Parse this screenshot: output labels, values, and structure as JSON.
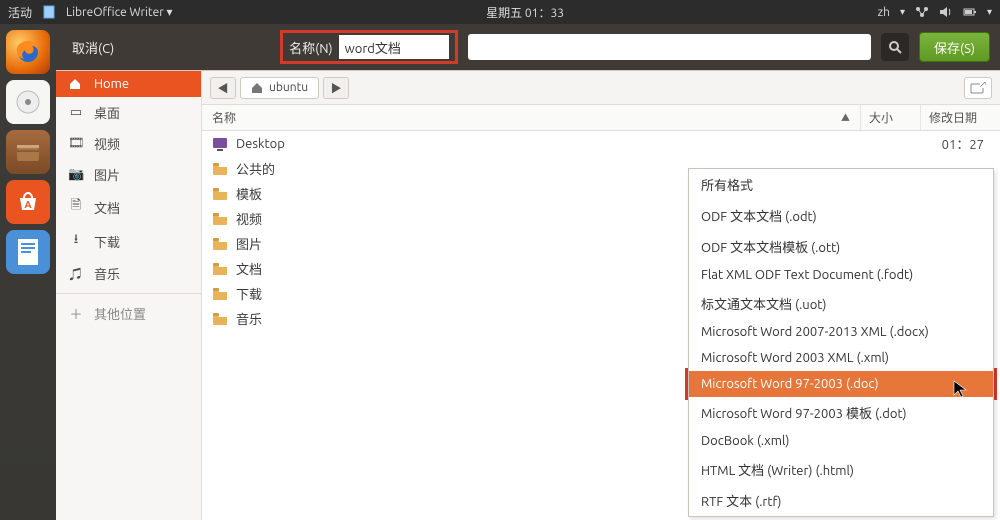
{
  "top": {
    "activities": "活动",
    "app_name": "LibreOffice Writer",
    "clock": "星期五 01：33",
    "lang": "zh"
  },
  "dialog": {
    "cancel": "取消(C)",
    "name_label": "名称(N)",
    "name_value": "word文档",
    "save": "保存(S)"
  },
  "places": {
    "home": "Home",
    "desktop": "桌面",
    "videos": "视频",
    "pictures": "图片",
    "documents": "文档",
    "downloads": "下载",
    "music": "音乐",
    "other": "其他位置"
  },
  "pathbar": {
    "segment": "ubuntu"
  },
  "columns": {
    "name": "名称",
    "size": "大小",
    "date": "修改日期"
  },
  "files": [
    {
      "icon": "desktop",
      "name": "Desktop",
      "date": "01：27"
    },
    {
      "icon": "folder",
      "name": "公共的",
      "date": ""
    },
    {
      "icon": "folder",
      "name": "模板",
      "date": ""
    },
    {
      "icon": "folder",
      "name": "视频",
      "date": ""
    },
    {
      "icon": "folder",
      "name": "图片",
      "date": ""
    },
    {
      "icon": "folder",
      "name": "文档",
      "date": ""
    },
    {
      "icon": "folder",
      "name": "下载",
      "date": ""
    },
    {
      "icon": "folder",
      "name": "音乐",
      "date": ""
    }
  ],
  "formats": [
    "所有格式",
    "ODF 文本文档 (.odt)",
    "ODF 文本文档模板 (.ott)",
    "Flat XML ODF Text Document (.fodt)",
    "标文通文本文档 (.uot)",
    "Microsoft Word 2007-2013 XML (.docx)",
    "Microsoft Word 2003 XML (.xml)",
    "Microsoft Word 97-2003 (.doc)",
    "Microsoft Word 97-2003 模板 (.dot)",
    "DocBook (.xml)",
    "HTML 文档 (Writer) (.html)",
    "RTF 文本 (.rtf)"
  ],
  "format_selected_index": 7
}
